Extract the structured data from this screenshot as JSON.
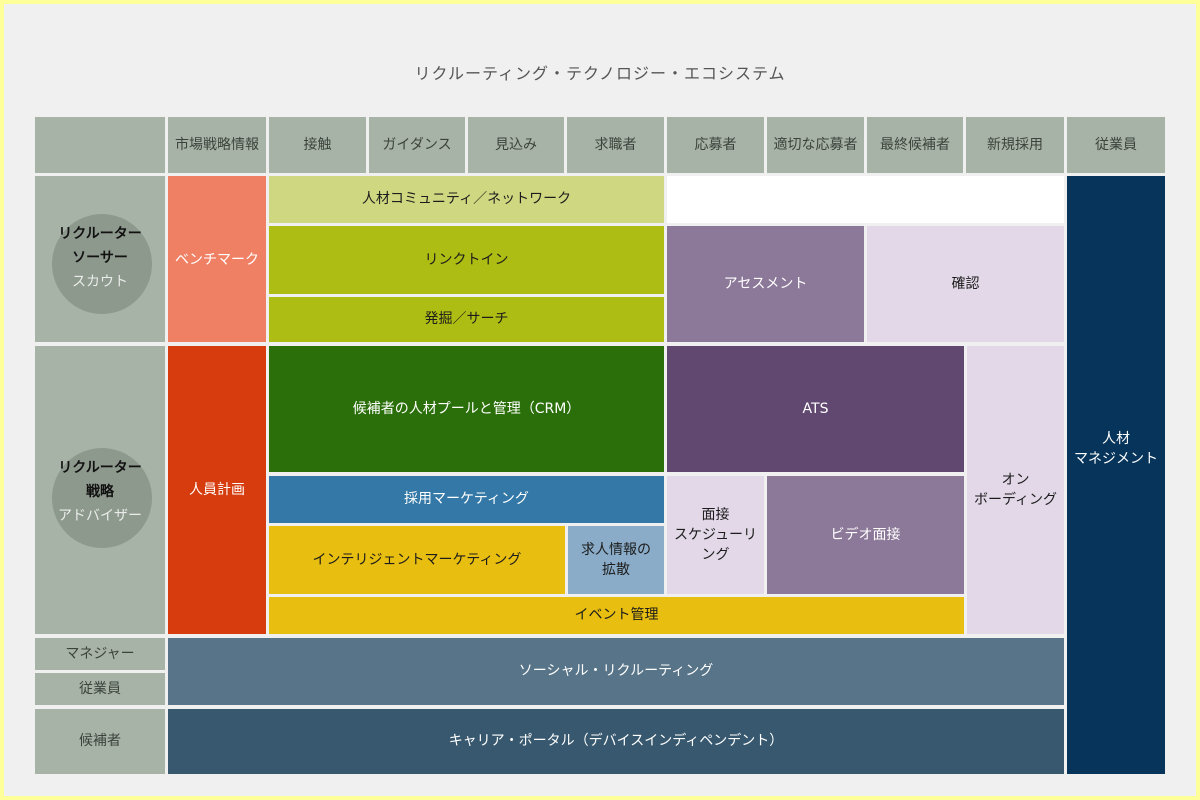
{
  "title": "リクルーティング・テクノロジー・エコシステム",
  "columns": [
    "市場戦略情報",
    "接触",
    "ガイダンス",
    "見込み",
    "求職者",
    "応募者",
    "適切な応募者",
    "最終候補者",
    "新規採用",
    "従業員"
  ],
  "rows": {
    "sourcer": {
      "line1": "リクルーター",
      "line2": "ソーサー",
      "sub": "スカウト"
    },
    "strategy": {
      "line1": "リクルーター",
      "line2": "戦略",
      "sub": "アドバイザー"
    },
    "manager": "マネジャー",
    "employee": "従業員",
    "candidate": "候補者"
  },
  "blocks": {
    "benchmark": "ベンチマーク",
    "community": "人材コミュニティ／ネットワーク",
    "linkedin": "リンクトイン",
    "search": "発掘／サーチ",
    "assessment": "アセスメント",
    "verification": "確認",
    "talent_management": "人材\nマネジメント",
    "workforce_planning": "人員計画",
    "crm": "候補者の人材プールと管理（CRM）",
    "ats": "ATS",
    "onboarding": "オン\nボーディング",
    "recruitment_marketing": "採用マーケティング",
    "interview_scheduling": "面接\nスケジューリング",
    "video_interview": "ビデオ面接",
    "intelligent_marketing": "インテリジェントマーケティング",
    "job_distribution": "求人情報の\n拡散",
    "event_management": "イベント管理",
    "social_recruiting": "ソーシャル・リクルーティング",
    "career_portal": "キャリア・ポータル（デバイスインディペンデント）"
  },
  "colors": {
    "header": "#a7b3a7",
    "benchmark": "#f08064",
    "community": "#cfd880",
    "linkedin": "#aebd13",
    "assessment": "#8c7898",
    "verification": "#e2d8e8",
    "talent_management": "#06345a",
    "workforce_planning": "#d63c0e",
    "crm": "#2b6f0a",
    "ats": "#604870",
    "recruitment_marketing": "#3378a6",
    "intelligent_marketing": "#e8be10",
    "job_distribution": "#8aacc8",
    "social_recruiting": "#587488",
    "career_portal": "#37586e"
  }
}
